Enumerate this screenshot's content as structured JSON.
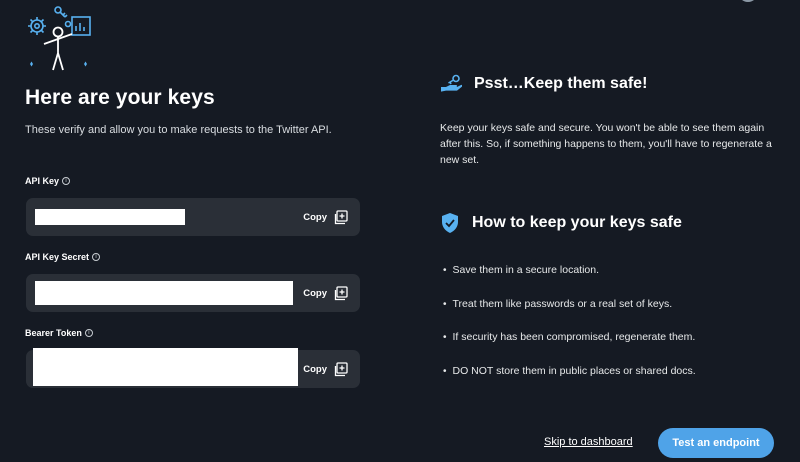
{
  "page": {
    "title": "Here are your keys",
    "subtitle": "These verify and allow you to make requests to the Twitter API."
  },
  "fields": [
    {
      "label": "API Key",
      "info": "i",
      "copy_label": "Copy"
    },
    {
      "label": "API Key Secret",
      "info": "i",
      "copy_label": "Copy"
    },
    {
      "label": "Bearer Token",
      "info": "i",
      "copy_label": "Copy"
    }
  ],
  "safe_section": {
    "heading": "Psst…Keep them safe!",
    "body": "Keep your keys safe and secure. You won't be able to see them again after this. So, if something happens to them, you'll have to regenerate a new set."
  },
  "howto_section": {
    "heading": "How to keep your keys safe",
    "tips": [
      "Save them in a secure location.",
      "Treat them like passwords or a real set of keys.",
      "If security has been compromised, regenerate them.",
      "DO NOT store them in public places or shared docs."
    ]
  },
  "footer": {
    "skip_label": "Skip to dashboard",
    "test_label": "Test an endpoint"
  },
  "icons": {
    "hero": "developer-illustration-icon",
    "safe": "hand-key-icon",
    "howto": "shield-check-icon",
    "copy": "copy-icon",
    "info": "info-icon"
  },
  "colors": {
    "background": "#151a23",
    "accent": "#4fa3e8",
    "field_bg": "#2a2f37"
  }
}
